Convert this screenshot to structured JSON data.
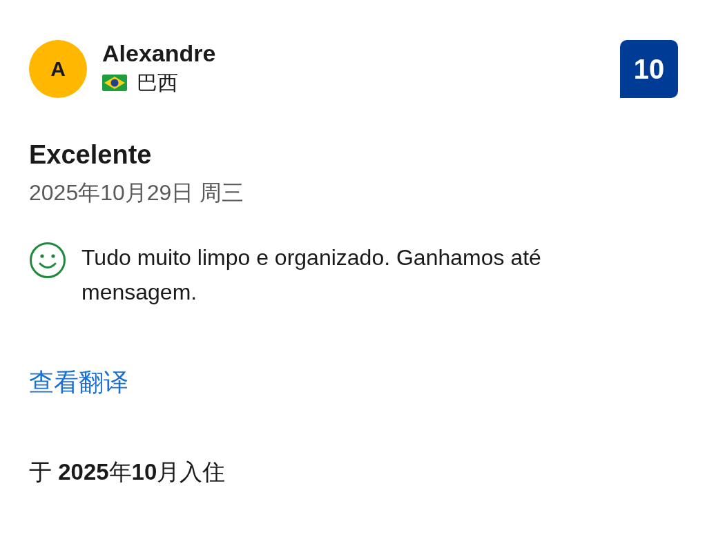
{
  "reviewer": {
    "initial": "A",
    "name": "Alexandre",
    "country": "巴西"
  },
  "score": "10",
  "title": "Excelente",
  "date": "2025年10月29日 周三",
  "positive": "Tudo muito limpo e organizado. Ganhamos até mensagem.",
  "translate_link": "查看翻译",
  "stay": "于 **2025**年**10**月入住"
}
